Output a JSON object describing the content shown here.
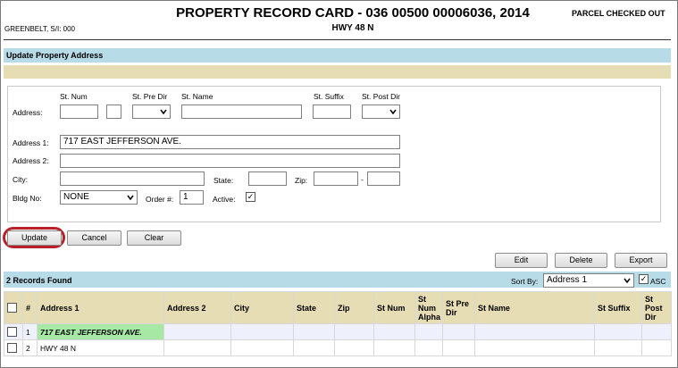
{
  "header": {
    "title": "PROPERTY RECORD CARD - 036 00500 00006036, 2014",
    "subtitle": "HWY 48 N",
    "owner": "GREENBELT, S/I: 000",
    "status": "PARCEL CHECKED OUT"
  },
  "section": {
    "title": "Update Property Address"
  },
  "form": {
    "col_labels": {
      "st_num": "St. Num",
      "st_pre_dir": "St. Pre Dir",
      "st_name": "St. Name",
      "st_suffix": "St. Suffix",
      "st_post_dir": "St. Post Dir"
    },
    "labels": {
      "address": "Address:",
      "address1": "Address 1:",
      "address2": "Address 2:",
      "city": "City:",
      "state": "State:",
      "zip": "Zip:",
      "zip_sep": "-",
      "bldg_no": "Bldg No:",
      "order": "Order #:",
      "active": "Active:"
    },
    "values": {
      "address1": "717 EAST JEFFERSON AVE.",
      "address2": "",
      "city": "",
      "state": "",
      "zip": "",
      "zip4": "",
      "bldg_no": "NONE",
      "order": "1",
      "active_mark": "✓"
    }
  },
  "buttons": {
    "update": "Update",
    "cancel": "Cancel",
    "clear": "Clear",
    "edit": "Edit",
    "delete": "Delete",
    "export": "Export"
  },
  "records": {
    "count_label": "2 Records Found",
    "sort_by_label": "Sort By:",
    "sort_by_value": "Address 1",
    "asc_label": "ASC",
    "asc_mark": "✓",
    "columns": [
      "#",
      "Address 1",
      "Address 2",
      "City",
      "State",
      "Zip",
      "St Num",
      "St Num Alpha",
      "St Pre Dir",
      "St Name",
      "St Suffix",
      "St Post Dir"
    ],
    "rows": [
      {
        "num": "1",
        "address1": "717 EAST JEFFERSON AVE."
      },
      {
        "num": "2",
        "address1": "HWY 48 N"
      }
    ]
  },
  "colors": {
    "section_bar": "#b8dbe8",
    "tan_bar": "#e7ddb5",
    "highlight_green": "#a6e8a4",
    "focus_ring": "#b8202a"
  }
}
